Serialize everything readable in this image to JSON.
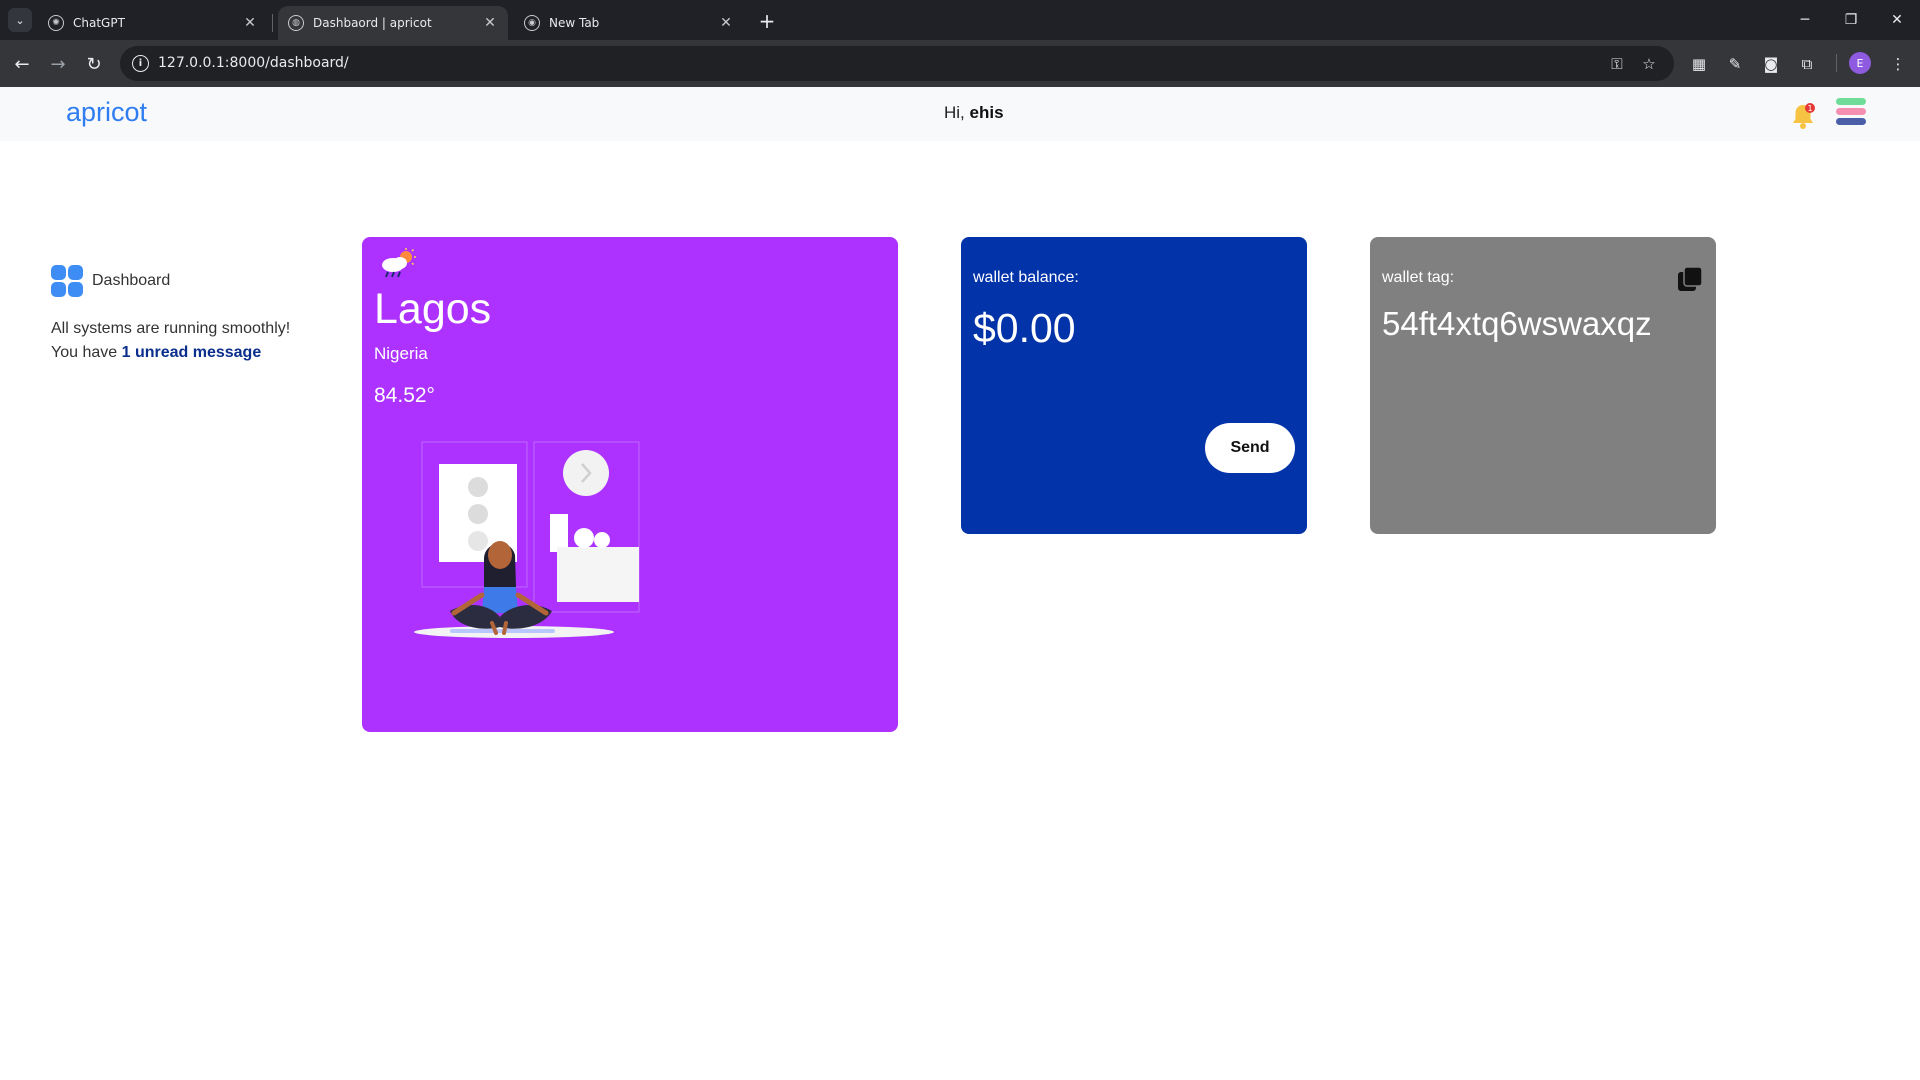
{
  "browser": {
    "tabs": [
      {
        "title": "ChatGPT",
        "icon": "chatgpt-favicon",
        "active": false
      },
      {
        "title": "Dashbaord | apricot",
        "icon": "globe-favicon",
        "active": true
      },
      {
        "title": "New Tab",
        "icon": "chrome-favicon",
        "active": false
      }
    ],
    "url": "127.0.0.1:8000/dashboard/",
    "profile_initial": "E"
  },
  "header": {
    "brand": "apricot",
    "greeting_prefix": "Hi,",
    "username": "ehis",
    "notification_count": "1"
  },
  "sidebar": {
    "dashboard_label": "Dashboard",
    "status_text": "All systems are running smoothly! You have ",
    "unread_link": "1 unread message"
  },
  "weather": {
    "city": "Lagos",
    "country": "Nigeria",
    "temperature": "84.52°",
    "icon": "cloud-sun-rain-icon",
    "background": "#ad32ff"
  },
  "wallet": {
    "label": "wallet balance:",
    "amount": "$0.00",
    "send_label": "Send",
    "background": "#0333a8"
  },
  "wallet_tag": {
    "label": "wallet tag:",
    "value": "54ft4xtq6wswaxqz",
    "background": "#808080"
  },
  "colors": {
    "brand": "#2f7df0",
    "link": "#0b2f8c"
  }
}
